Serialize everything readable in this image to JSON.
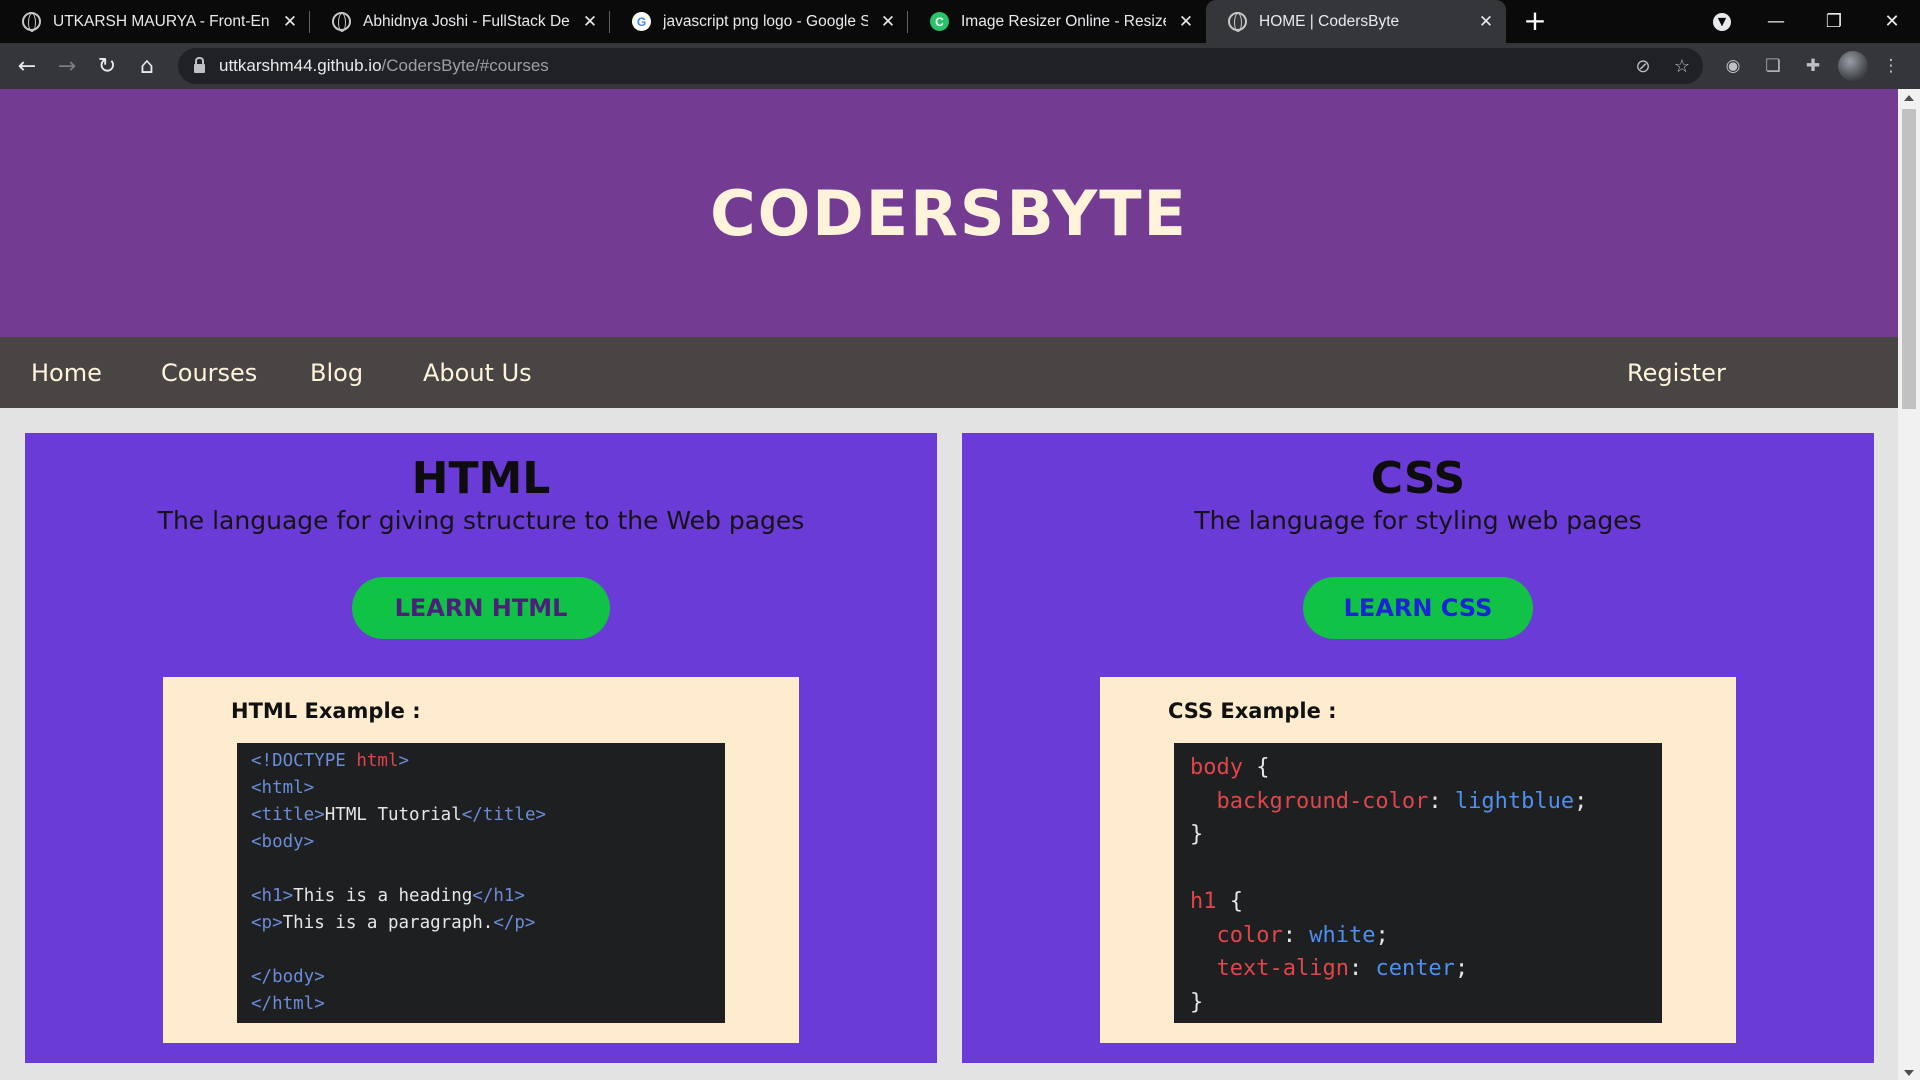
{
  "browser": {
    "tabs": [
      {
        "title": "UTKARSH MAURYA - Front-End D",
        "icon": "globe-icon",
        "active": false
      },
      {
        "title": "Abhidnya Joshi - FullStack Develo",
        "icon": "globe-icon",
        "active": false
      },
      {
        "title": "javascript png logo - Google Sea",
        "icon": "google-icon",
        "active": false
      },
      {
        "title": "Image Resizer Online - Resize JPG",
        "icon": "resizer-icon",
        "active": false
      },
      {
        "title": "HOME | CodersByte",
        "icon": "globe-icon",
        "active": true
      }
    ],
    "url_host": "uttkarshm44.github.io",
    "url_path": "/CodersByte/#courses",
    "colors": {
      "tabstrip": "#0a0a0a",
      "toolbar": "#35363a",
      "omnibox": "#202124"
    }
  },
  "site": {
    "title": "CODERSBYTE",
    "nav": {
      "links": [
        "Home",
        "Courses",
        "Blog",
        "About Us"
      ],
      "register": "Register"
    },
    "colors": {
      "header": "#743b93",
      "nav": "#484544",
      "card": "#6a3bd7",
      "button": "#10c245",
      "example_bg": "#ffeccf"
    }
  },
  "courses": {
    "html": {
      "title": "HTML",
      "subtitle": "The language for giving structure to the Web pages",
      "button": "LEARN HTML",
      "button_text_color": "#4b1f7a",
      "example_label": "HTML Example :",
      "code_lines": [
        [
          {
            "t": "<!DOCTYPE ",
            "c": "c-tag"
          },
          {
            "t": "html",
            "c": "c-kw"
          },
          {
            "t": ">",
            "c": "c-tag"
          }
        ],
        [
          {
            "t": "<html>",
            "c": "c-tag"
          }
        ],
        [
          {
            "t": "<title>",
            "c": "c-tag"
          },
          {
            "t": "HTML Tutorial",
            "c": "c-txt"
          },
          {
            "t": "</title>",
            "c": "c-tag"
          }
        ],
        [
          {
            "t": "<body>",
            "c": "c-tag"
          }
        ],
        [],
        [
          {
            "t": "<h1>",
            "c": "c-tag"
          },
          {
            "t": "This is a heading",
            "c": "c-txt"
          },
          {
            "t": "</h1>",
            "c": "c-tag"
          }
        ],
        [
          {
            "t": "<p>",
            "c": "c-tag"
          },
          {
            "t": "This is a paragraph.",
            "c": "c-txt"
          },
          {
            "t": "</p>",
            "c": "c-tag"
          }
        ],
        [],
        [
          {
            "t": "</body>",
            "c": "c-tag"
          }
        ],
        [
          {
            "t": "</html>",
            "c": "c-tag"
          }
        ]
      ]
    },
    "css": {
      "title": "CSS",
      "subtitle": "The language for styling web pages",
      "button": "LEARN CSS",
      "button_text_color": "#1c24d6",
      "example_label": "CSS Example :",
      "code_lines": [
        [
          {
            "t": "body",
            "c": "c-prop"
          },
          {
            "t": " {",
            "c": "c-txt"
          }
        ],
        [
          {
            "t": "  background-color",
            "c": "c-prop"
          },
          {
            "t": ": ",
            "c": "c-txt"
          },
          {
            "t": "lightblue",
            "c": "c-val"
          },
          {
            "t": ";",
            "c": "c-txt"
          }
        ],
        [
          {
            "t": "}",
            "c": "c-txt"
          }
        ],
        [],
        [
          {
            "t": "h1",
            "c": "c-prop"
          },
          {
            "t": " {",
            "c": "c-txt"
          }
        ],
        [
          {
            "t": "  color",
            "c": "c-prop"
          },
          {
            "t": ": ",
            "c": "c-txt"
          },
          {
            "t": "white",
            "c": "c-val"
          },
          {
            "t": ";",
            "c": "c-txt"
          }
        ],
        [
          {
            "t": "  text-align",
            "c": "c-prop"
          },
          {
            "t": ": ",
            "c": "c-txt"
          },
          {
            "t": "center",
            "c": "c-val"
          },
          {
            "t": ";",
            "c": "c-txt"
          }
        ],
        [
          {
            "t": "}",
            "c": "c-txt"
          }
        ]
      ]
    }
  }
}
